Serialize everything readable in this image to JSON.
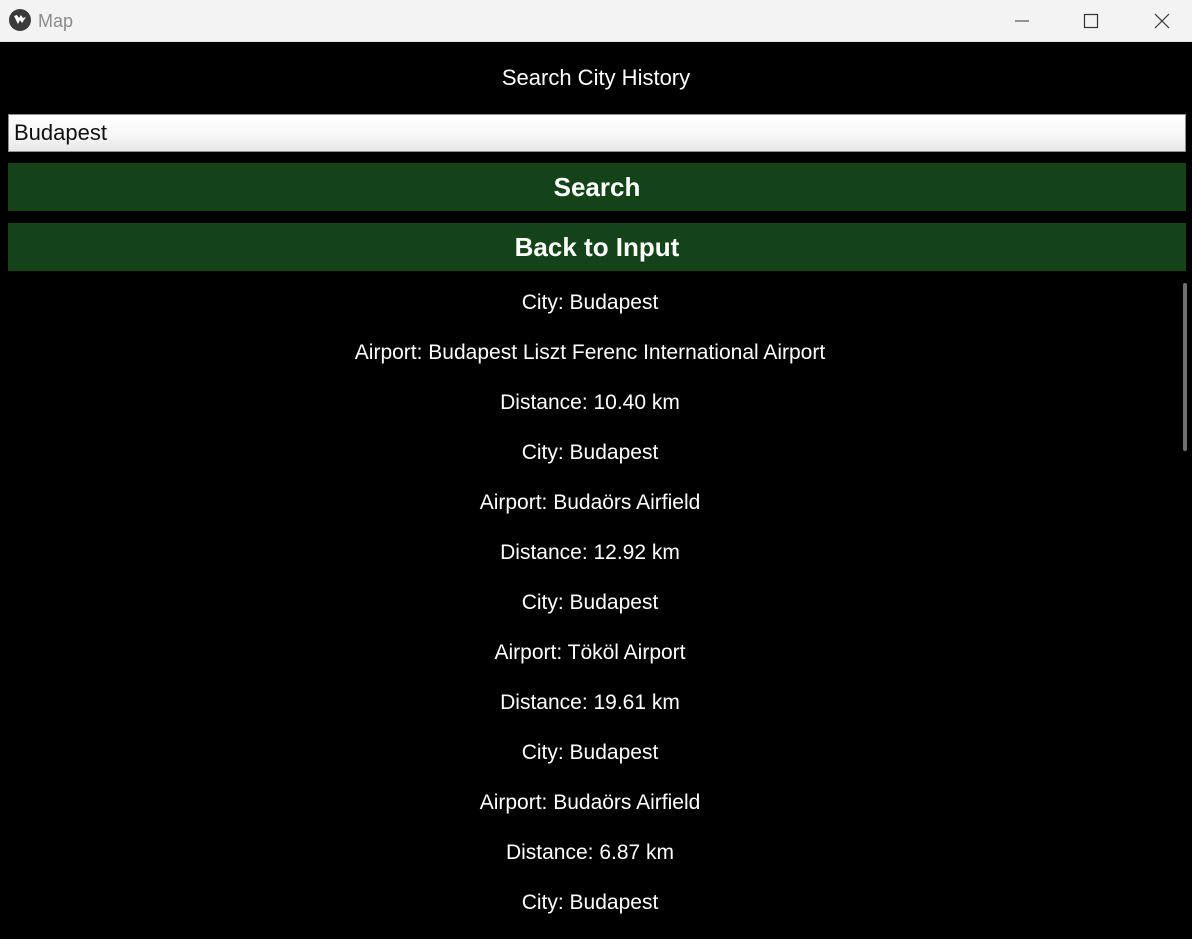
{
  "window": {
    "title": "Map"
  },
  "header": {
    "title": "Search City History"
  },
  "search": {
    "value": "Budapest",
    "button_label": "Search"
  },
  "back_button": {
    "label": "Back to Input"
  },
  "results": [
    "City: Budapest",
    "Airport: Budapest Liszt Ferenc International Airport",
    "Distance: 10.40 km",
    "City: Budapest",
    "Airport: Budaörs Airfield",
    "Distance: 12.92 km",
    "City: Budapest",
    "Airport: Tököl Airport",
    "Distance: 19.61 km",
    "City: Budapest",
    "Airport: Budaörs Airfield",
    "Distance: 6.87 km",
    "City: Budapest"
  ],
  "colors": {
    "background": "#000000",
    "button": "#144318",
    "text": "#ffffff"
  },
  "icons": [
    "app-icon",
    "minimize-icon",
    "maximize-icon",
    "close-icon"
  ]
}
